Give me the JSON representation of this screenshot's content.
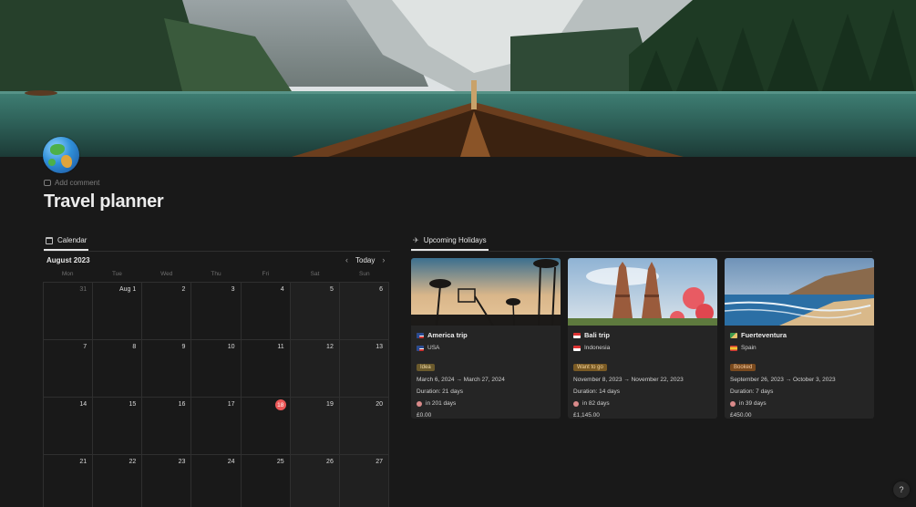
{
  "page": {
    "icon": "globe-icon",
    "add_comment": "Add comment",
    "title": "Travel planner"
  },
  "calendar": {
    "tab_label": "Calendar",
    "month": "August 2023",
    "today_label": "Today",
    "weekdays": [
      "Mon",
      "Tue",
      "Wed",
      "Thu",
      "Fri",
      "Sat",
      "Sun"
    ],
    "today_day": "18",
    "days": [
      "31",
      "Aug 1",
      "2",
      "3",
      "4",
      "5",
      "6",
      "7",
      "8",
      "9",
      "10",
      "11",
      "12",
      "13",
      "14",
      "15",
      "16",
      "17",
      "18",
      "19",
      "20",
      "21",
      "22",
      "23",
      "24",
      "25",
      "26",
      "27"
    ]
  },
  "holidays": {
    "tab_label": "Upcoming Holidays",
    "cards": [
      {
        "title": "America trip",
        "country": "USA",
        "status": "Idea",
        "status_color": "#6b5a2c",
        "status_text_color": "#f0d9a6",
        "dates": "March 6, 2024 → March 27, 2024",
        "duration": "Duration: 21 days",
        "countdown": "in 201 days",
        "cost": "£0.00"
      },
      {
        "title": "Bali trip",
        "country": "Indonesia",
        "status": "Want to go",
        "status_color": "#7a5a24",
        "status_text_color": "#f3d39a",
        "dates": "November 8, 2023 → November 22, 2023",
        "duration": "Duration: 14 days",
        "countdown": "in 82 days",
        "cost": "£1,145.00"
      },
      {
        "title": "Fuerteventura",
        "country": "Spain",
        "status": "Booked",
        "status_color": "#7a4a1e",
        "status_text_color": "#f5c89a",
        "dates": "September 26, 2023 → October 3, 2023",
        "duration": "Duration: 7 days",
        "countdown": "in 39 days",
        "cost": "£450.00"
      }
    ]
  },
  "help_label": "?"
}
